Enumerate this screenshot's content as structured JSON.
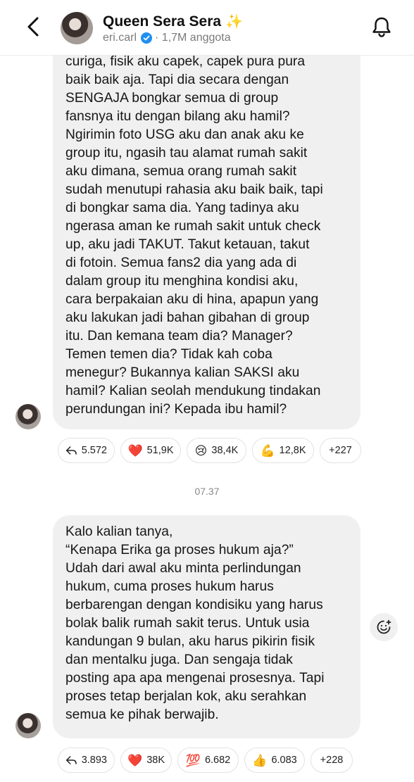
{
  "header": {
    "title": "Queen Sera Sera",
    "title_emoji": "✨",
    "handle": "eri.carl",
    "members": "· 1,7M anggota"
  },
  "messages": [
    {
      "text": "curiga, fisik aku capek, capek pura pura\nbaik baik aja. Tapi dia secara dengan\nSENGAJA bongkar semua di group\nfansnya itu dengan bilang aku hamil?\nNgirimin foto USG aku dan anak aku ke\ngroup itu, ngasih tau alamat rumah sakit\naku dimana, semua orang rumah sakit\nsudah menutupi rahasia aku baik baik, tapi\ndi bongkar sama dia. Yang tadinya aku\nngerasa aman ke rumah sakit untuk check\nup, aku jadi TAKUT. Takut ketauan, takut\ndi fotoin. Semua fans2 dia yang ada di\ndalam group itu menghina kondisi aku,\ncara berpakaian aku di hina, apapun yang\naku lakukan jadi bahan gibahan di group\nitu. Dan kemana team dia? Manager?\nTemen temen dia? Tidak kah coba\nmenegur? Bukannya kalian SAKSI aku\nhamil? Kalian seolah mendukung tindakan\nperundungan ini? Kepada ibu hamil?",
      "reactions": [
        {
          "emoji": "↩",
          "count": "5.572"
        },
        {
          "emoji": "❤️",
          "count": "51,9K"
        },
        {
          "emoji": "😢",
          "count": "38,4K"
        },
        {
          "emoji": "💪",
          "count": "12,8K"
        },
        {
          "emoji": "",
          "count": "+227"
        }
      ]
    },
    {
      "timestamp": "07.37",
      "text": "Kalo kalian tanya,\n“Kenapa Erika ga proses hukum aja?”\nUdah dari awal aku minta perlindungan\nhukum, cuma proses hukum harus\nberbarengan dengan kondisiku yang harus\nbolak balik rumah sakit terus. Untuk usia\nkandungan 9 bulan, aku harus pikirin fisik\ndan mentalku juga. Dan sengaja tidak\nposting apa apa mengenai prosesnya. Tapi\nproses tetap berjalan kok, aku serahkan\nsemua ke pihak berwajib.",
      "reactions": [
        {
          "emoji": "↩",
          "count": "3.893"
        },
        {
          "emoji": "❤️",
          "count": "38K"
        },
        {
          "emoji": "💯",
          "count": "6.682"
        },
        {
          "emoji": "👍",
          "count": "6.083"
        },
        {
          "emoji": "",
          "count": "+228"
        }
      ]
    }
  ],
  "icons": {
    "back": "chevron-left-icon",
    "bell": "bell-icon",
    "verified": "verified-badge-icon",
    "add_reaction": "add-reaction-icon"
  },
  "colors": {
    "verified": "#1f8ef1",
    "bubble": "#f0f0f0",
    "heart": "#e0245e"
  }
}
